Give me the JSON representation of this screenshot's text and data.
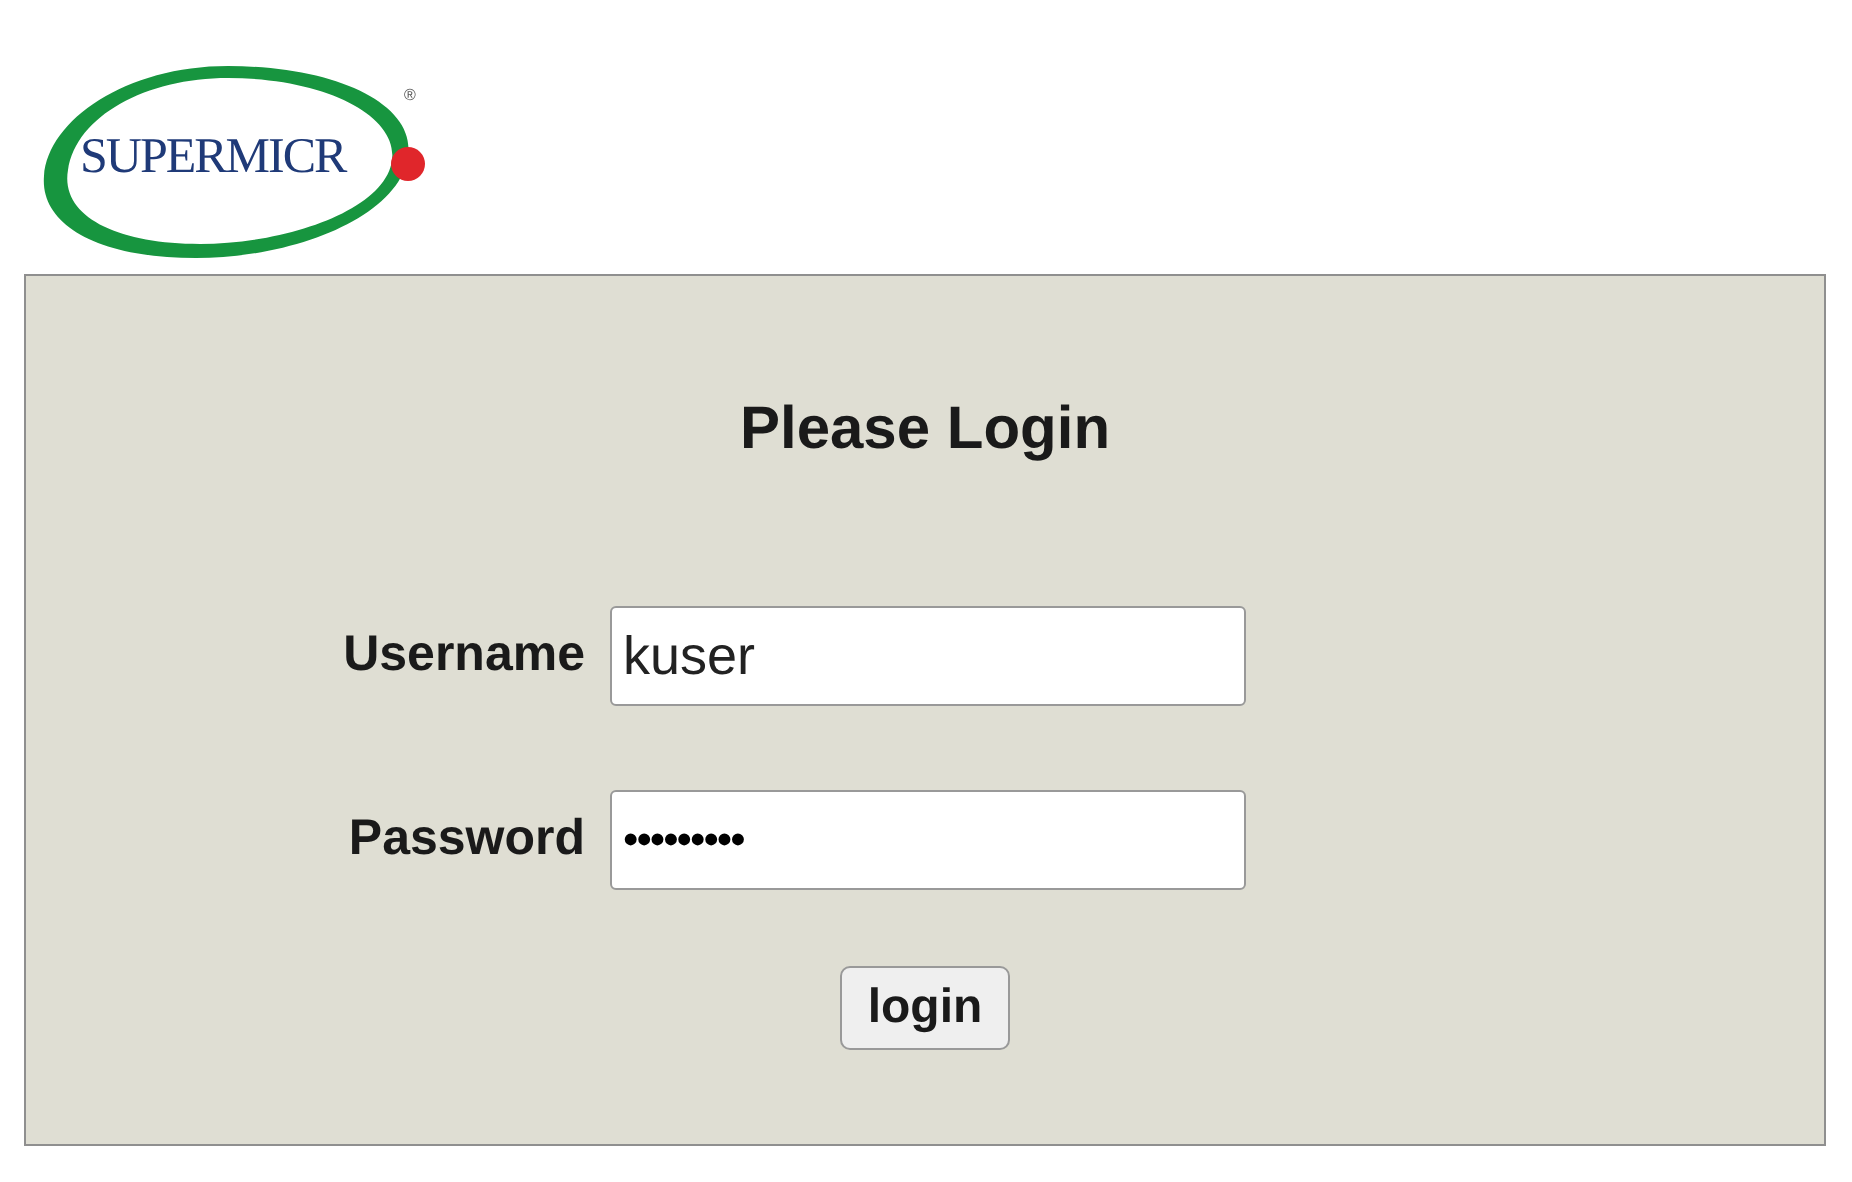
{
  "logo": {
    "text": "SUPERMICR",
    "mark": "®"
  },
  "form": {
    "title": "Please Login",
    "fields": [
      {
        "label": "Username",
        "kind": "text",
        "value": "kuser"
      },
      {
        "label": "Password",
        "kind": "password",
        "value": "•••••••••"
      }
    ],
    "button": "login"
  }
}
